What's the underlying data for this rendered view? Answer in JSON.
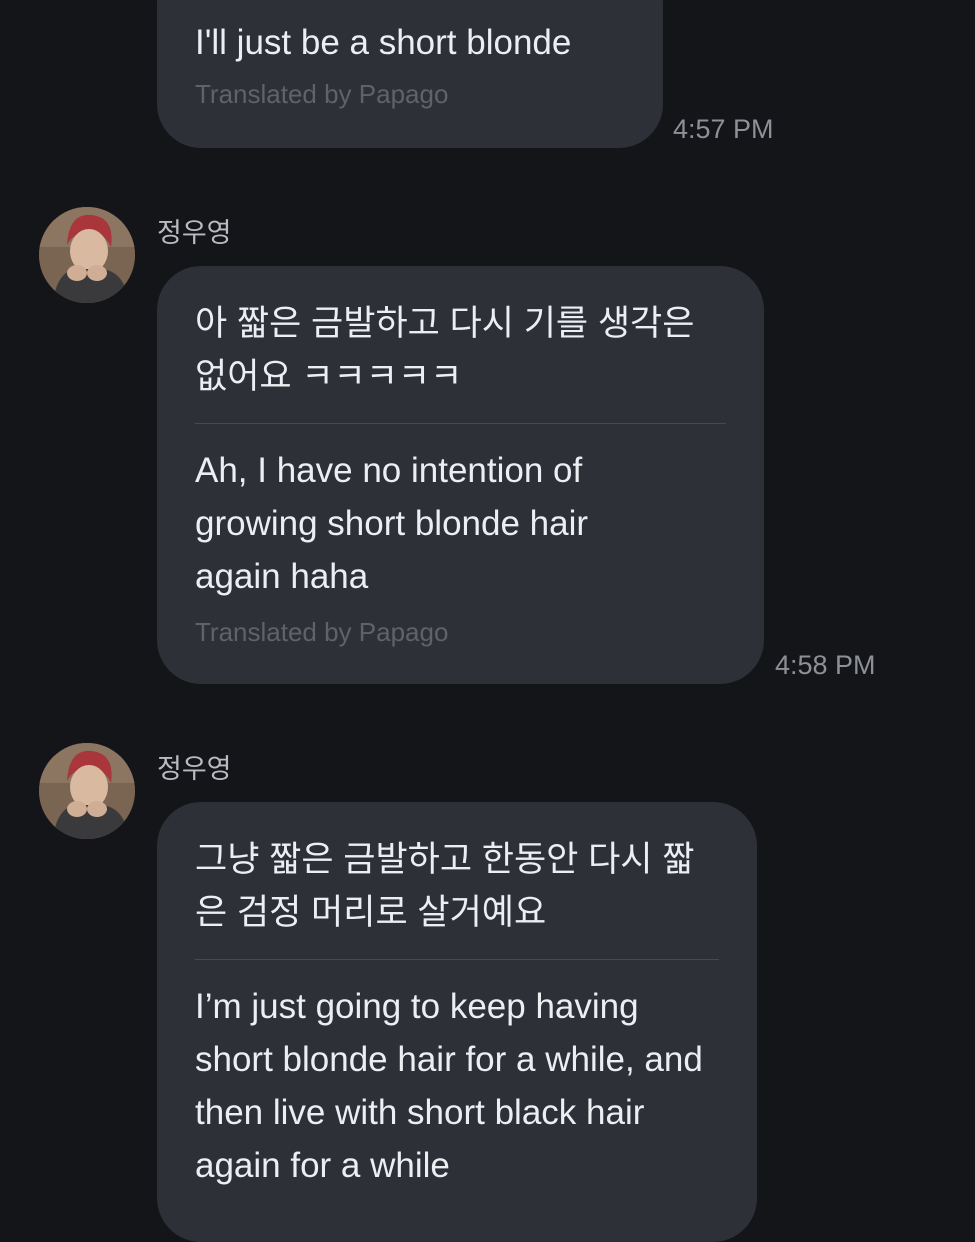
{
  "messages": [
    {
      "text": "I'll just be a short blonde",
      "translated_by": "Translated by Papago",
      "time": "4:57 PM"
    },
    {
      "sender": "정우영",
      "original": "아 짧은 금발하고 다시 기를 생각은 없어요 ㅋㅋㅋㅋㅋ",
      "translation": "Ah, I have no intention of growing short blonde hair again haha",
      "translated_by": "Translated by Papago",
      "time": "4:58 PM"
    },
    {
      "sender": "정우영",
      "original": "그냥 짧은 금발하고 한동안 다시 짧은 검정 머리로 살거예요",
      "translation": "I’m just going to keep having short blonde hair for a while, and then live with short black hair again for a while"
    }
  ],
  "avatar_icon": "profile-photo"
}
